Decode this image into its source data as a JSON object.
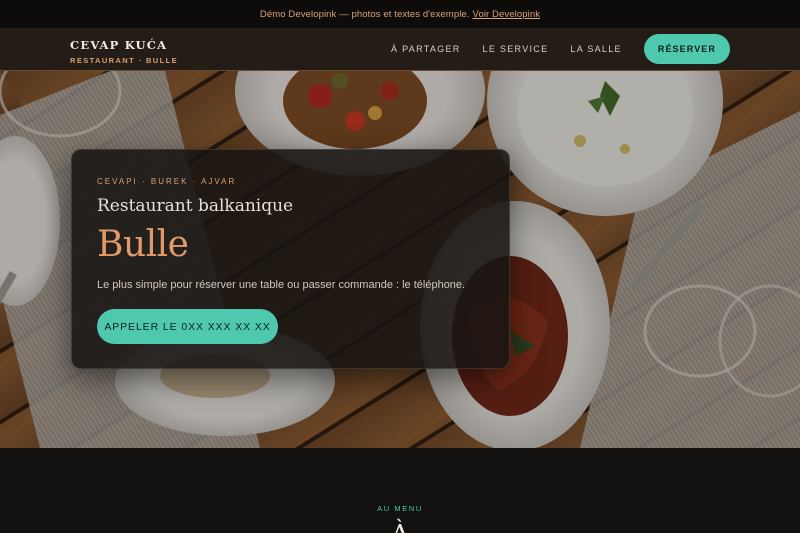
{
  "demo_bar": {
    "text": "Démo Developink — photos et textes d'exemple.",
    "link": "Voir Developink"
  },
  "brand": {
    "name": "CEVAP KUĆA",
    "subtitle": "RESTAURANT · BULLE"
  },
  "nav": {
    "items": [
      "À PARTAGER",
      "LE SERVICE",
      "LA SALLE"
    ],
    "cta": "RÉSERVER"
  },
  "hero": {
    "eyebrow": "CEVAPI · BUREK · AJVAR",
    "subtitle": "Restaurant balkanique",
    "title": "Bulle",
    "text": "Le plus simple pour réserver une table ou passer commande : le téléphone.",
    "cta": "APPELER LE 0XX XXX XX XX"
  },
  "menu_section": {
    "eyebrow": "AU MENU",
    "heading_peek": "À"
  },
  "colors": {
    "accent": "#4fc9ae",
    "brand_copper": "#d9a071",
    "title_copper": "#e29a68",
    "background": "#121110"
  }
}
